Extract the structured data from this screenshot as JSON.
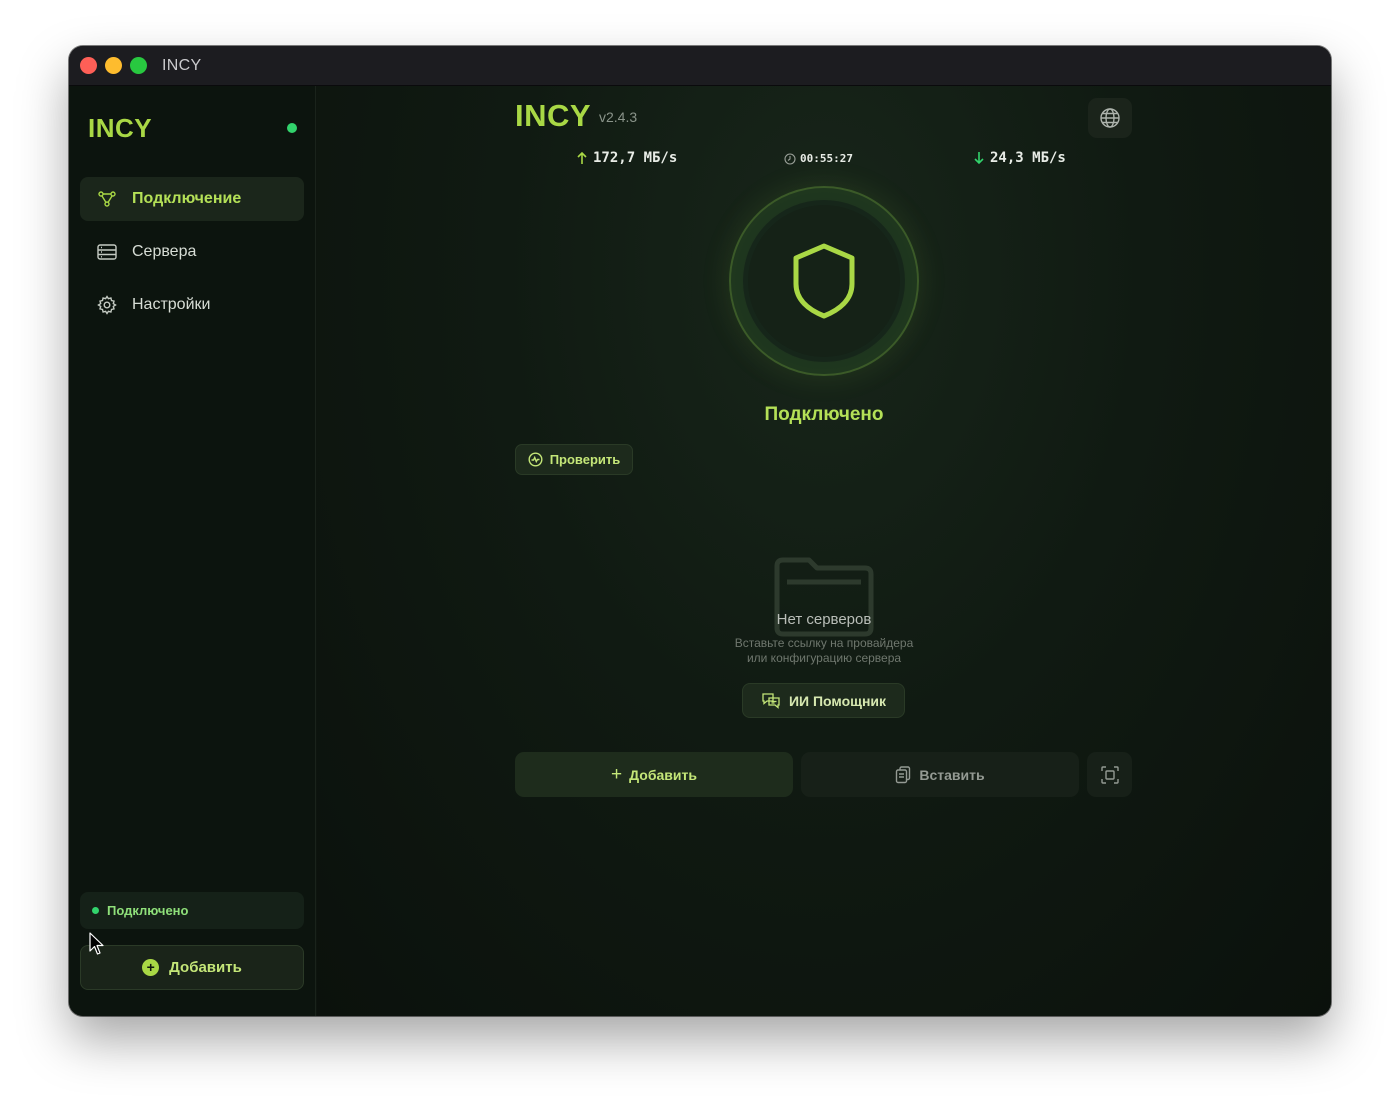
{
  "window": {
    "title": "INCY"
  },
  "sidebar": {
    "brand": "INCY",
    "items": [
      {
        "label": "Подключение",
        "icon": "nodes-icon",
        "active": true
      },
      {
        "label": "Сервера",
        "icon": "server-list-icon",
        "active": false
      },
      {
        "label": "Настройки",
        "icon": "gear-icon",
        "active": false
      }
    ],
    "status": "Подключено",
    "add_label": "Добавить"
  },
  "main": {
    "title": "INCY",
    "version": "v2.4.3",
    "stats": {
      "upload": "172,7 МБ/s",
      "timer": "00:55:27",
      "download": "24,3 МБ/s"
    },
    "connection_status": "Подключено",
    "check_label": "Проверить",
    "empty": {
      "title": "Нет серверов",
      "subtitle_line1": "Вставьте ссылку на провайдера",
      "subtitle_line2": "или конфигурацию сервера"
    },
    "ai_label": "ИИ Помощник",
    "add_label": "Добавить",
    "paste_label": "Вставить"
  },
  "colors": {
    "accent": "#a9d845",
    "status_green": "#32d36c",
    "background": "#0e150f"
  }
}
